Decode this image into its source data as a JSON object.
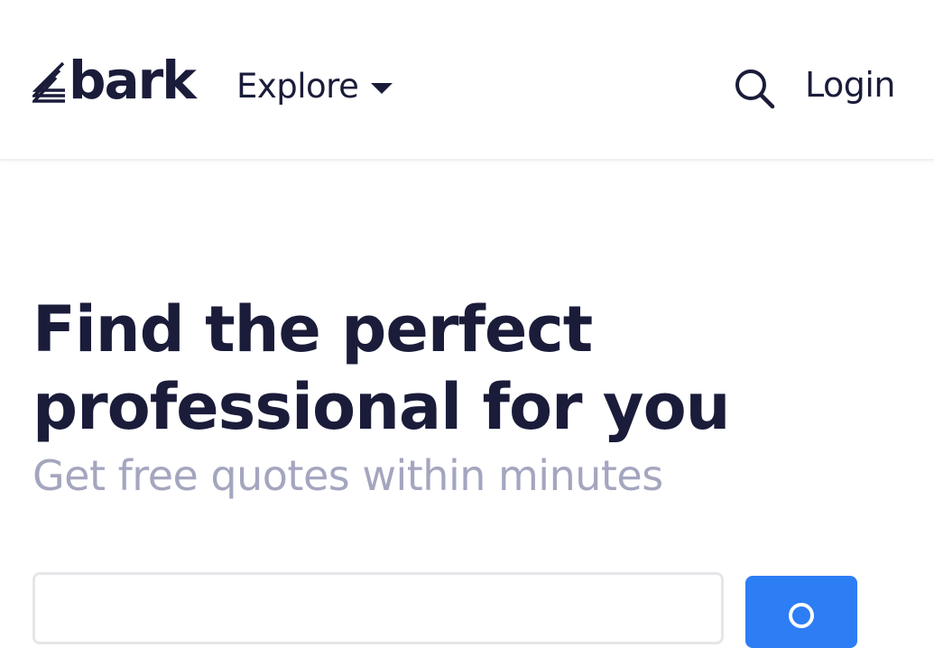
{
  "brand": {
    "name": "bark",
    "icon": "bark-logo-icon"
  },
  "header": {
    "explore_label": "Explore",
    "explore_icon": "caret-down-icon",
    "search_icon": "search-icon",
    "login_label": "Login"
  },
  "hero": {
    "headline_line1": "Find the perfect",
    "headline_line2": "professional for you",
    "subtitle": "Get free quotes within minutes"
  },
  "search": {
    "value": "",
    "placeholder": ""
  },
  "colors": {
    "text_primary": "#1a1c3a",
    "text_muted": "#a4a6bf",
    "accent": "#2d7df5"
  }
}
